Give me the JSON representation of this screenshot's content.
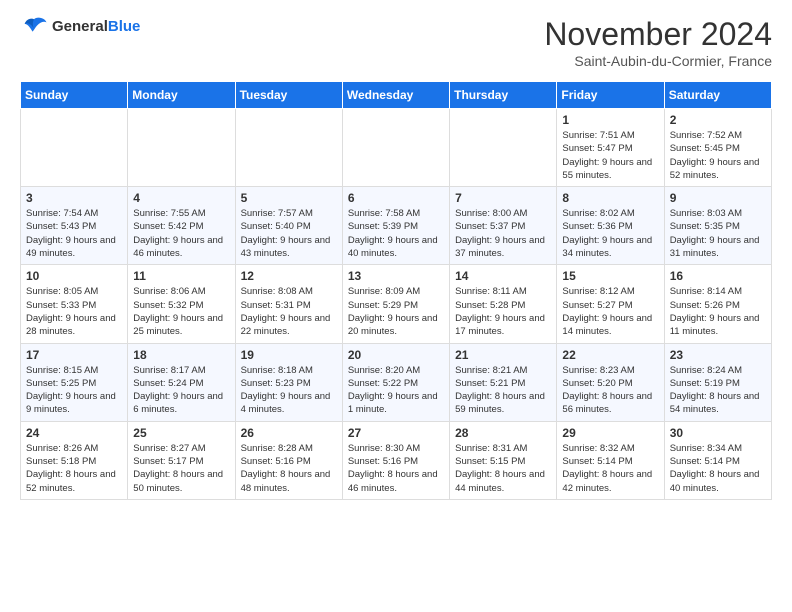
{
  "header": {
    "logo_general": "General",
    "logo_blue": "Blue",
    "month_title": "November 2024",
    "location": "Saint-Aubin-du-Cormier, France"
  },
  "weekdays": [
    "Sunday",
    "Monday",
    "Tuesday",
    "Wednesday",
    "Thursday",
    "Friday",
    "Saturday"
  ],
  "weeks": [
    [
      {
        "day": "",
        "info": ""
      },
      {
        "day": "",
        "info": ""
      },
      {
        "day": "",
        "info": ""
      },
      {
        "day": "",
        "info": ""
      },
      {
        "day": "",
        "info": ""
      },
      {
        "day": "1",
        "info": "Sunrise: 7:51 AM\nSunset: 5:47 PM\nDaylight: 9 hours and 55 minutes."
      },
      {
        "day": "2",
        "info": "Sunrise: 7:52 AM\nSunset: 5:45 PM\nDaylight: 9 hours and 52 minutes."
      }
    ],
    [
      {
        "day": "3",
        "info": "Sunrise: 7:54 AM\nSunset: 5:43 PM\nDaylight: 9 hours and 49 minutes."
      },
      {
        "day": "4",
        "info": "Sunrise: 7:55 AM\nSunset: 5:42 PM\nDaylight: 9 hours and 46 minutes."
      },
      {
        "day": "5",
        "info": "Sunrise: 7:57 AM\nSunset: 5:40 PM\nDaylight: 9 hours and 43 minutes."
      },
      {
        "day": "6",
        "info": "Sunrise: 7:58 AM\nSunset: 5:39 PM\nDaylight: 9 hours and 40 minutes."
      },
      {
        "day": "7",
        "info": "Sunrise: 8:00 AM\nSunset: 5:37 PM\nDaylight: 9 hours and 37 minutes."
      },
      {
        "day": "8",
        "info": "Sunrise: 8:02 AM\nSunset: 5:36 PM\nDaylight: 9 hours and 34 minutes."
      },
      {
        "day": "9",
        "info": "Sunrise: 8:03 AM\nSunset: 5:35 PM\nDaylight: 9 hours and 31 minutes."
      }
    ],
    [
      {
        "day": "10",
        "info": "Sunrise: 8:05 AM\nSunset: 5:33 PM\nDaylight: 9 hours and 28 minutes."
      },
      {
        "day": "11",
        "info": "Sunrise: 8:06 AM\nSunset: 5:32 PM\nDaylight: 9 hours and 25 minutes."
      },
      {
        "day": "12",
        "info": "Sunrise: 8:08 AM\nSunset: 5:31 PM\nDaylight: 9 hours and 22 minutes."
      },
      {
        "day": "13",
        "info": "Sunrise: 8:09 AM\nSunset: 5:29 PM\nDaylight: 9 hours and 20 minutes."
      },
      {
        "day": "14",
        "info": "Sunrise: 8:11 AM\nSunset: 5:28 PM\nDaylight: 9 hours and 17 minutes."
      },
      {
        "day": "15",
        "info": "Sunrise: 8:12 AM\nSunset: 5:27 PM\nDaylight: 9 hours and 14 minutes."
      },
      {
        "day": "16",
        "info": "Sunrise: 8:14 AM\nSunset: 5:26 PM\nDaylight: 9 hours and 11 minutes."
      }
    ],
    [
      {
        "day": "17",
        "info": "Sunrise: 8:15 AM\nSunset: 5:25 PM\nDaylight: 9 hours and 9 minutes."
      },
      {
        "day": "18",
        "info": "Sunrise: 8:17 AM\nSunset: 5:24 PM\nDaylight: 9 hours and 6 minutes."
      },
      {
        "day": "19",
        "info": "Sunrise: 8:18 AM\nSunset: 5:23 PM\nDaylight: 9 hours and 4 minutes."
      },
      {
        "day": "20",
        "info": "Sunrise: 8:20 AM\nSunset: 5:22 PM\nDaylight: 9 hours and 1 minute."
      },
      {
        "day": "21",
        "info": "Sunrise: 8:21 AM\nSunset: 5:21 PM\nDaylight: 8 hours and 59 minutes."
      },
      {
        "day": "22",
        "info": "Sunrise: 8:23 AM\nSunset: 5:20 PM\nDaylight: 8 hours and 56 minutes."
      },
      {
        "day": "23",
        "info": "Sunrise: 8:24 AM\nSunset: 5:19 PM\nDaylight: 8 hours and 54 minutes."
      }
    ],
    [
      {
        "day": "24",
        "info": "Sunrise: 8:26 AM\nSunset: 5:18 PM\nDaylight: 8 hours and 52 minutes."
      },
      {
        "day": "25",
        "info": "Sunrise: 8:27 AM\nSunset: 5:17 PM\nDaylight: 8 hours and 50 minutes."
      },
      {
        "day": "26",
        "info": "Sunrise: 8:28 AM\nSunset: 5:16 PM\nDaylight: 8 hours and 48 minutes."
      },
      {
        "day": "27",
        "info": "Sunrise: 8:30 AM\nSunset: 5:16 PM\nDaylight: 8 hours and 46 minutes."
      },
      {
        "day": "28",
        "info": "Sunrise: 8:31 AM\nSunset: 5:15 PM\nDaylight: 8 hours and 44 minutes."
      },
      {
        "day": "29",
        "info": "Sunrise: 8:32 AM\nSunset: 5:14 PM\nDaylight: 8 hours and 42 minutes."
      },
      {
        "day": "30",
        "info": "Sunrise: 8:34 AM\nSunset: 5:14 PM\nDaylight: 8 hours and 40 minutes."
      }
    ]
  ]
}
